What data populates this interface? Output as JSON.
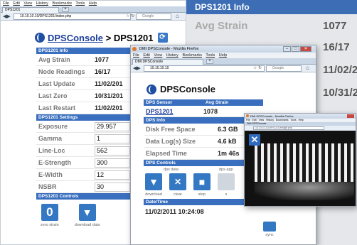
{
  "browser1": {
    "menu": [
      "File",
      "Edit",
      "View",
      "History",
      "Bookmarks",
      "Tools",
      "Help"
    ],
    "tab_title": "DPS1201",
    "url": "10.10.10.10/DPS1201/index.php",
    "search_placeholder": "Google",
    "brand": "DPSConsole",
    "crumb_sep": " > ",
    "crumb_current": "DPS1201",
    "info_header": "DPS1201 Info",
    "info": [
      {
        "label": "Avg Strain",
        "value": "1077"
      },
      {
        "label": "Node Readings",
        "value": "16/17"
      },
      {
        "label": "Last Update",
        "value": "11/02/201"
      },
      {
        "label": "Last Zero",
        "value": "10/31/201"
      },
      {
        "label": "Last Restart",
        "value": "11/02/201"
      }
    ],
    "settings_header": "DPS1201 Settings",
    "settings": [
      {
        "label": "Exposure",
        "value": "29.957"
      },
      {
        "label": "Gamma",
        "value": "1"
      },
      {
        "label": "Line-Loc",
        "value": "562"
      },
      {
        "label": "E-Strength",
        "value": "300"
      },
      {
        "label": "E-Width",
        "value": "12"
      },
      {
        "label": "NSBR",
        "value": "30"
      }
    ],
    "controls_header": "DPS1201 Controls",
    "controls": [
      {
        "glyph": "0",
        "label": "zero strain"
      },
      {
        "glyph": "▼",
        "label": "download data"
      }
    ]
  },
  "right_bg": {
    "title": "DPS1201 Info",
    "rows": [
      {
        "label": "Avg Strain",
        "value": "1077"
      },
      {
        "label": "",
        "value": "16/17"
      },
      {
        "label": "",
        "value": "11/02/2"
      },
      {
        "label": "",
        "value": "10/31/2"
      }
    ]
  },
  "browser2": {
    "title": "DMI DPSConsole - Mozilla Firefox",
    "menu": [
      "File",
      "Edit",
      "View",
      "History",
      "Bookmarks",
      "Tools",
      "Help"
    ],
    "tab_title": "DMI DPSConsole",
    "url": "10.10.10.10",
    "search_placeholder": "Google",
    "brand": "DPSConsole",
    "table_headers": [
      "DPS Sensor",
      "Avg Strain"
    ],
    "sensor_name": "DPS1201",
    "sensor_strain": "1078",
    "info_header": "DPS Info",
    "info": [
      {
        "label": "Disk Free Space",
        "value": "6.3 GB"
      },
      {
        "label": "Data Log(s) Size",
        "value": "4.6 kB"
      },
      {
        "label": "Elapsed Time",
        "value": "1m 46s"
      }
    ],
    "controls_header": "DPS Controls",
    "subheads": [
      "dps data",
      "dps app"
    ],
    "controls": [
      {
        "glyph": "▼",
        "label": "download"
      },
      {
        "glyph": "✕",
        "label": "clear"
      },
      {
        "glyph": "■",
        "label": "stop"
      },
      {
        "glyph": "",
        "label": "s"
      }
    ],
    "datetime_header": "Date/Time",
    "datetime": "11/02/2011 10:24:08",
    "sync_label": "sync"
  },
  "browser3": {
    "title": "DMI DPSConsole - Mozilla Firefox",
    "menu": [
      "File",
      "Edit",
      "View",
      "History",
      "Bookmarks",
      "Tools",
      "Help"
    ],
    "tab_title": "DMI DPSConsole",
    "url": "10.10.10.10/DPS1201/image.php"
  },
  "colors": {
    "accent": "#3a6fbf",
    "link": "#1d3f9c",
    "bg_gray": "#e9ecef"
  }
}
